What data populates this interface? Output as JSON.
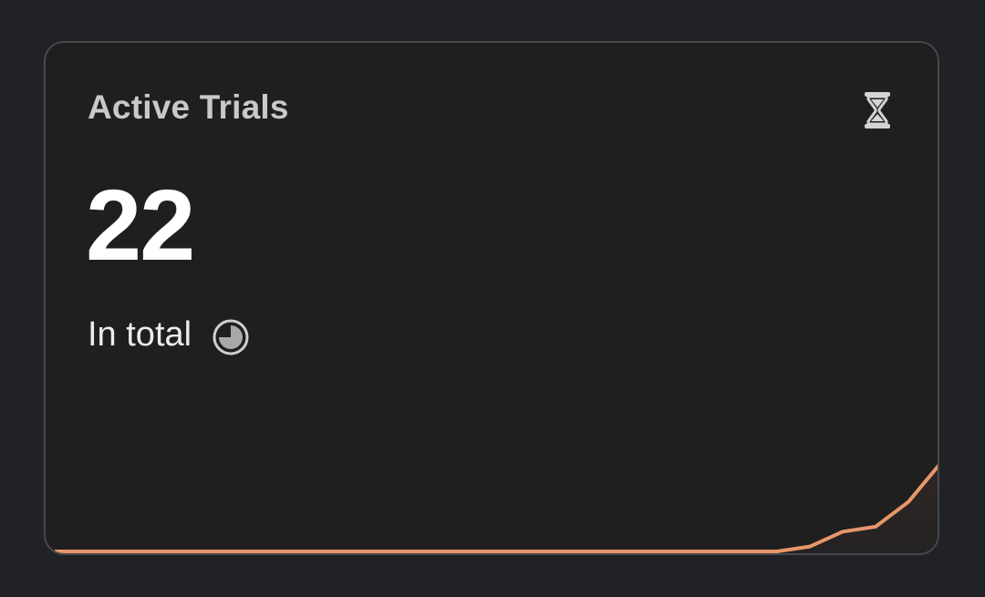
{
  "card": {
    "title": "Active Trials",
    "value": "22",
    "subtitle": "In total",
    "icon": "hourglass-icon",
    "subtitle_icon": "clock-icon"
  },
  "colors": {
    "background": "#212226",
    "card_background": "#1f1f20",
    "card_border": "#47484c",
    "accent_line": "#e7966a",
    "title": "#c9c9c9",
    "value": "#ffffff"
  },
  "chart_data": {
    "type": "area",
    "title": "",
    "xlabel": "",
    "ylabel": "",
    "grid": false,
    "x": [
      0,
      1,
      2,
      3,
      4,
      5,
      6,
      7,
      8,
      9,
      10,
      11,
      12,
      13,
      14,
      15,
      16,
      17,
      18,
      19,
      20,
      21,
      22,
      23,
      24,
      25,
      26,
      27
    ],
    "series": [
      {
        "values": [
          0,
          0,
          0,
          0,
          0,
          0,
          0,
          0,
          0,
          0,
          0,
          0,
          0,
          0,
          0,
          0,
          0,
          0,
          0,
          0,
          0,
          0,
          0,
          1,
          4,
          5,
          10,
          18
        ]
      }
    ],
    "ylim": [
      0,
      28
    ]
  }
}
